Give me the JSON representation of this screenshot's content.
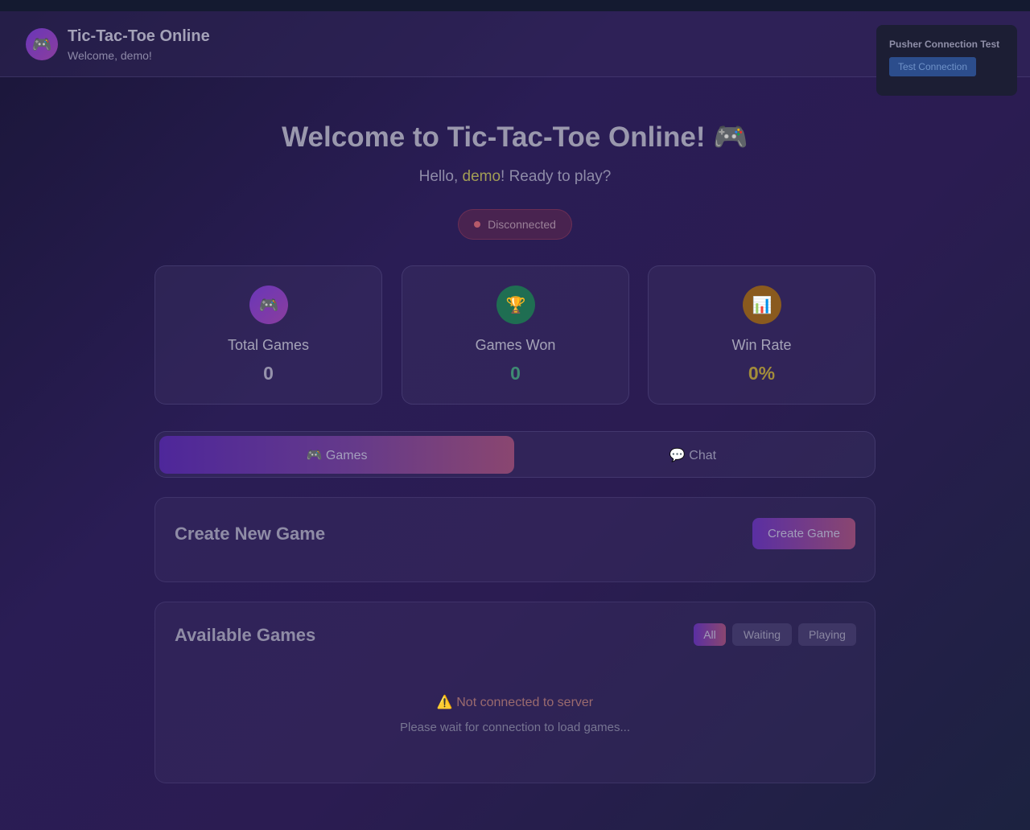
{
  "header": {
    "logo_icon": "🎮",
    "title": "Tic-Tac-Toe Online",
    "subtitle": "Welcome, demo!"
  },
  "pusher": {
    "title": "Pusher Connection Test",
    "button_label": "Test Connection"
  },
  "hero": {
    "title": "Welcome to Tic-Tac-Toe Online! 🎮",
    "greeting_prefix": "Hello, ",
    "username": "demo",
    "greeting_suffix": "! Ready to play?"
  },
  "connection": {
    "status": "Disconnected",
    "status_color": "#b65a6a"
  },
  "stats": [
    {
      "icon": "🎮",
      "icon_name": "gamepad-icon",
      "label": "Total Games",
      "value": "0",
      "color": "#9693ac",
      "bg": "linear-gradient(135deg,#6a37b8,#8a3d9e)"
    },
    {
      "icon": "🏆",
      "icon_name": "trophy-icon",
      "label": "Games Won",
      "value": "0",
      "color": "#3f8a73",
      "bg": "#1f6e52"
    },
    {
      "icon": "📊",
      "icon_name": "bar-chart-icon",
      "label": "Win Rate",
      "value": "0%",
      "color": "#a38d3a",
      "bg": "#8a5a1e"
    }
  ],
  "tabs": {
    "games": "🎮 Games",
    "chat": "💬 Chat",
    "active": "games"
  },
  "create_game": {
    "title": "Create New Game",
    "button_label": "Create Game"
  },
  "available_games": {
    "title": "Available Games",
    "filters": [
      "All",
      "Waiting",
      "Playing"
    ],
    "active_filter": "All",
    "empty_icon": "⚠️",
    "empty_title": "Not connected to server",
    "empty_subtitle": "Please wait for connection to load games..."
  }
}
